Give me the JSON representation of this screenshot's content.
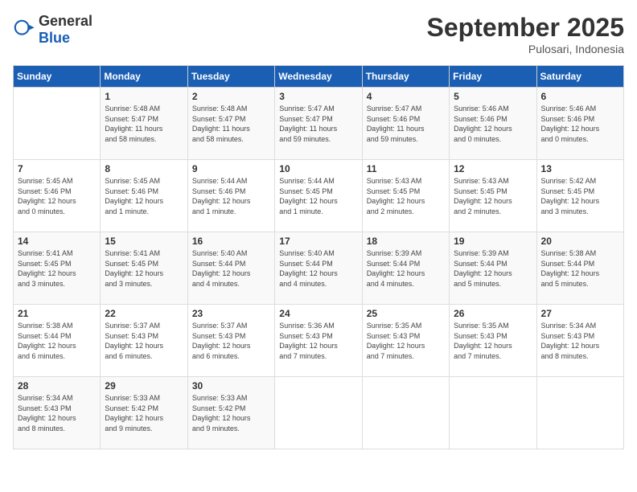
{
  "header": {
    "logo_general": "General",
    "logo_blue": "Blue",
    "month_title": "September 2025",
    "subtitle": "Pulosari, Indonesia"
  },
  "weekdays": [
    "Sunday",
    "Monday",
    "Tuesday",
    "Wednesday",
    "Thursday",
    "Friday",
    "Saturday"
  ],
  "weeks": [
    [
      {
        "day": "",
        "info": ""
      },
      {
        "day": "1",
        "info": "Sunrise: 5:48 AM\nSunset: 5:47 PM\nDaylight: 11 hours\nand 58 minutes."
      },
      {
        "day": "2",
        "info": "Sunrise: 5:48 AM\nSunset: 5:47 PM\nDaylight: 11 hours\nand 58 minutes."
      },
      {
        "day": "3",
        "info": "Sunrise: 5:47 AM\nSunset: 5:47 PM\nDaylight: 11 hours\nand 59 minutes."
      },
      {
        "day": "4",
        "info": "Sunrise: 5:47 AM\nSunset: 5:46 PM\nDaylight: 11 hours\nand 59 minutes."
      },
      {
        "day": "5",
        "info": "Sunrise: 5:46 AM\nSunset: 5:46 PM\nDaylight: 12 hours\nand 0 minutes."
      },
      {
        "day": "6",
        "info": "Sunrise: 5:46 AM\nSunset: 5:46 PM\nDaylight: 12 hours\nand 0 minutes."
      }
    ],
    [
      {
        "day": "7",
        "info": "Sunrise: 5:45 AM\nSunset: 5:46 PM\nDaylight: 12 hours\nand 0 minutes."
      },
      {
        "day": "8",
        "info": "Sunrise: 5:45 AM\nSunset: 5:46 PM\nDaylight: 12 hours\nand 1 minute."
      },
      {
        "day": "9",
        "info": "Sunrise: 5:44 AM\nSunset: 5:46 PM\nDaylight: 12 hours\nand 1 minute."
      },
      {
        "day": "10",
        "info": "Sunrise: 5:44 AM\nSunset: 5:45 PM\nDaylight: 12 hours\nand 1 minute."
      },
      {
        "day": "11",
        "info": "Sunrise: 5:43 AM\nSunset: 5:45 PM\nDaylight: 12 hours\nand 2 minutes."
      },
      {
        "day": "12",
        "info": "Sunrise: 5:43 AM\nSunset: 5:45 PM\nDaylight: 12 hours\nand 2 minutes."
      },
      {
        "day": "13",
        "info": "Sunrise: 5:42 AM\nSunset: 5:45 PM\nDaylight: 12 hours\nand 3 minutes."
      }
    ],
    [
      {
        "day": "14",
        "info": "Sunrise: 5:41 AM\nSunset: 5:45 PM\nDaylight: 12 hours\nand 3 minutes."
      },
      {
        "day": "15",
        "info": "Sunrise: 5:41 AM\nSunset: 5:45 PM\nDaylight: 12 hours\nand 3 minutes."
      },
      {
        "day": "16",
        "info": "Sunrise: 5:40 AM\nSunset: 5:44 PM\nDaylight: 12 hours\nand 4 minutes."
      },
      {
        "day": "17",
        "info": "Sunrise: 5:40 AM\nSunset: 5:44 PM\nDaylight: 12 hours\nand 4 minutes."
      },
      {
        "day": "18",
        "info": "Sunrise: 5:39 AM\nSunset: 5:44 PM\nDaylight: 12 hours\nand 4 minutes."
      },
      {
        "day": "19",
        "info": "Sunrise: 5:39 AM\nSunset: 5:44 PM\nDaylight: 12 hours\nand 5 minutes."
      },
      {
        "day": "20",
        "info": "Sunrise: 5:38 AM\nSunset: 5:44 PM\nDaylight: 12 hours\nand 5 minutes."
      }
    ],
    [
      {
        "day": "21",
        "info": "Sunrise: 5:38 AM\nSunset: 5:44 PM\nDaylight: 12 hours\nand 6 minutes."
      },
      {
        "day": "22",
        "info": "Sunrise: 5:37 AM\nSunset: 5:43 PM\nDaylight: 12 hours\nand 6 minutes."
      },
      {
        "day": "23",
        "info": "Sunrise: 5:37 AM\nSunset: 5:43 PM\nDaylight: 12 hours\nand 6 minutes."
      },
      {
        "day": "24",
        "info": "Sunrise: 5:36 AM\nSunset: 5:43 PM\nDaylight: 12 hours\nand 7 minutes."
      },
      {
        "day": "25",
        "info": "Sunrise: 5:35 AM\nSunset: 5:43 PM\nDaylight: 12 hours\nand 7 minutes."
      },
      {
        "day": "26",
        "info": "Sunrise: 5:35 AM\nSunset: 5:43 PM\nDaylight: 12 hours\nand 7 minutes."
      },
      {
        "day": "27",
        "info": "Sunrise: 5:34 AM\nSunset: 5:43 PM\nDaylight: 12 hours\nand 8 minutes."
      }
    ],
    [
      {
        "day": "28",
        "info": "Sunrise: 5:34 AM\nSunset: 5:43 PM\nDaylight: 12 hours\nand 8 minutes."
      },
      {
        "day": "29",
        "info": "Sunrise: 5:33 AM\nSunset: 5:42 PM\nDaylight: 12 hours\nand 9 minutes."
      },
      {
        "day": "30",
        "info": "Sunrise: 5:33 AM\nSunset: 5:42 PM\nDaylight: 12 hours\nand 9 minutes."
      },
      {
        "day": "",
        "info": ""
      },
      {
        "day": "",
        "info": ""
      },
      {
        "day": "",
        "info": ""
      },
      {
        "day": "",
        "info": ""
      }
    ]
  ]
}
